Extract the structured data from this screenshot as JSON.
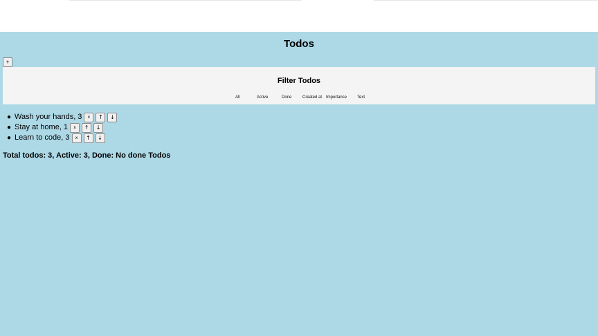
{
  "app": {
    "title": "Todos",
    "add_button_label": "+"
  },
  "filter": {
    "title": "Filter Todos",
    "options": [
      "All",
      "Active",
      "Done",
      "Created at",
      "Importance",
      "Text"
    ]
  },
  "todos": [
    {
      "label": "Wash your hands, 3",
      "remove": "x",
      "up": "↑",
      "down": "↓"
    },
    {
      "label": "Stay at home, 1",
      "remove": "x",
      "up": "↑",
      "down": "↓"
    },
    {
      "label": "Learn to code, 3",
      "remove": "x",
      "up": "↑",
      "down": "↓"
    }
  ],
  "summary": {
    "text": "Total todos: 3, Active: 3, Done: No done Todos"
  },
  "colors": {
    "background": "#add8e6",
    "filter_panel": "#f4f4f4",
    "button": "#f0f0f0"
  }
}
